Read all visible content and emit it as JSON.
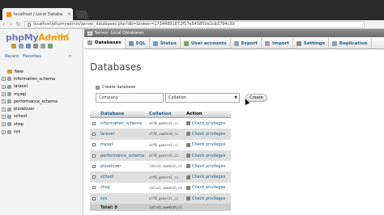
{
  "browser": {
    "tab_title": "localhost / Local Databa",
    "tab_close": "×",
    "url": "localhost/phpmyadmin/server_databases.php?db=&token=17344891872f57e545850e1cb3794c39"
  },
  "sidebar": {
    "logo": {
      "php": "php",
      "my": "My",
      "admin": "Admin"
    },
    "recent_label": "Recent",
    "favorites_label": "Favorites",
    "tree": [
      {
        "label": "New",
        "type": "new"
      },
      {
        "label": "information_schema",
        "type": "db"
      },
      {
        "label": "laravel",
        "type": "db"
      },
      {
        "label": "mysql",
        "type": "db"
      },
      {
        "label": "performance_schema",
        "type": "db"
      },
      {
        "label": "pizzalover",
        "type": "db"
      },
      {
        "label": "school",
        "type": "db"
      },
      {
        "label": "shop",
        "type": "db"
      },
      {
        "label": "sys",
        "type": "db"
      }
    ]
  },
  "main": {
    "server_breadcrumb": "Server: Local Databases",
    "menu": [
      {
        "label": "Databases",
        "icon": "database-icon",
        "color": "#9aa0a8",
        "active": true
      },
      {
        "label": "SQL",
        "icon": "sql-icon",
        "color": "#7d8fa8"
      },
      {
        "label": "Status",
        "icon": "status-icon",
        "color": "#6e9fd1"
      },
      {
        "label": "User accounts",
        "icon": "users-icon",
        "color": "#7aa36b"
      },
      {
        "label": "Export",
        "icon": "export-icon",
        "color": "#9aa0a8"
      },
      {
        "label": "Import",
        "icon": "import-icon",
        "color": "#9aa0a8"
      },
      {
        "label": "Settings",
        "icon": "settings-icon",
        "color": "#8c8c8c"
      },
      {
        "label": "Replication",
        "icon": "replication-icon",
        "color": "#9aa0a8"
      }
    ],
    "page_title": "Databases",
    "create": {
      "label": "Create database",
      "name_value": "Company",
      "collation_value": "Collation",
      "button_label": "Create"
    },
    "table": {
      "headers": {
        "database": "Database",
        "collation": "Collation",
        "action": "Action"
      },
      "rows": [
        {
          "name": "information_schema",
          "collation": "utf8_general_ci",
          "action": "Check privileges"
        },
        {
          "name": "laravel",
          "collation": "utf8_swedish_ci",
          "action": "Check privileges"
        },
        {
          "name": "mysql",
          "collation": "utf8_general_ci",
          "action": "Check privileges"
        },
        {
          "name": "performance_schema",
          "collation": "utf8_general_ci",
          "action": "Check privileges"
        },
        {
          "name": "pizzalover",
          "collation": "latin1_swedish_ci",
          "action": "Check privileges"
        },
        {
          "name": "school",
          "collation": "utf8_general_ci",
          "action": "Check privileges"
        },
        {
          "name": "shop",
          "collation": "latin1_swedish_ci",
          "action": "Check privileges"
        },
        {
          "name": "sys",
          "collation": "utf8_general_ci",
          "action": "Check privileges"
        }
      ],
      "footer": {
        "total": "Total: 8",
        "collation": "latin1_swedish_ci"
      }
    }
  }
}
